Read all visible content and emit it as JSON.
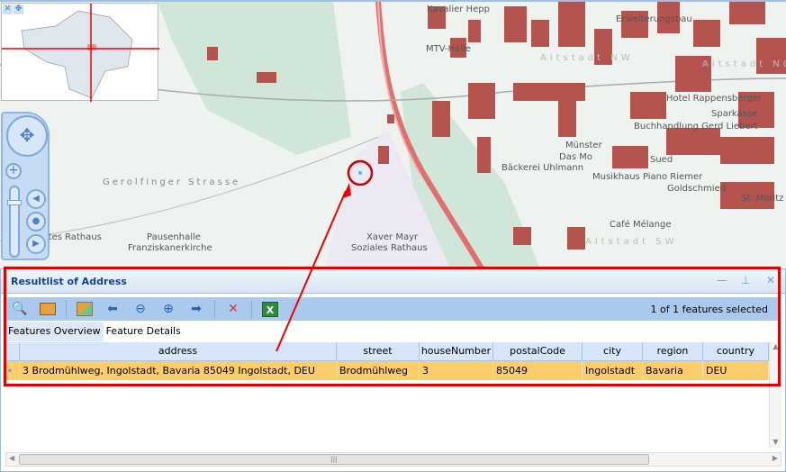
{
  "map": {
    "labels": [
      "Kavalier Hepp",
      "MTV-Halle",
      "Erweiterungsbau",
      "Altstadt NW",
      "Altstadt NO",
      "Hotel Rappensberger",
      "Sparkasse",
      "Buchhandlung Gerd Liebert",
      "Münster",
      "Das Mo",
      "Bäckerei Uhlmann",
      "Musikhaus Piano Riemer",
      "Goldschmied",
      "St. Moritz",
      "Café Mélange",
      "Altstadt SW",
      "Gerolfinger Strasse",
      "Altes Rathaus",
      "Pausenhalle",
      "Franziskanerkirche",
      "Xaver Mayr",
      "Soziales Rathaus",
      "Sued"
    ],
    "overview_tools": [
      "✕",
      "✥"
    ]
  },
  "panel": {
    "title": "Resultlist of Address",
    "controls": [
      "—",
      "⊥",
      "✕"
    ],
    "selection_status": "1 of 1 features selected",
    "tabs": [
      "Features Overview",
      "Feature Details"
    ],
    "active_tab": "Feature Details",
    "columns": [
      "address",
      "street",
      "houseNumber",
      "postalCode",
      "city",
      "region",
      "country"
    ],
    "rows": [
      {
        "address": "3 Brodmühlweg, Ingolstadt, Bavaria 85049 Ingolstadt, DEU",
        "street": "Brodmühlweg",
        "houseNumber": "3",
        "postalCode": "85049",
        "city": "Ingolstadt",
        "region": "Bavaria",
        "country": "DEU"
      }
    ]
  },
  "colors": {
    "highlight": "#e00000",
    "selected_row": "#fdcd6b",
    "toolbar": "#a9c9ed",
    "building": "#b5534f"
  }
}
